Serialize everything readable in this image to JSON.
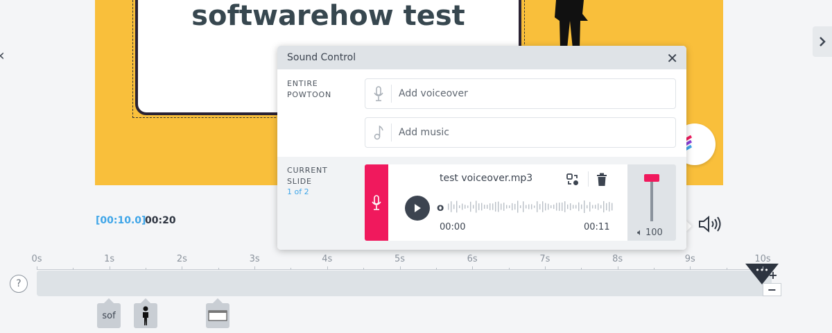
{
  "slide": {
    "title": "softwarehow test"
  },
  "player": {
    "current_time": "[00:10.0]",
    "total_time": "00:20"
  },
  "timeline": {
    "labels": [
      "0s",
      "1s",
      "2s",
      "3s",
      "4s",
      "5s",
      "6s",
      "7s",
      "8s",
      "9s",
      "10s"
    ],
    "help": "?",
    "zoom_in": "+",
    "zoom_out": "−",
    "marker_glyph": "•••",
    "thumbs": [
      {
        "label": "sof",
        "icon": "text-icon"
      },
      {
        "label": "",
        "icon": "person-icon"
      },
      {
        "label": "",
        "icon": "frame-icon"
      }
    ]
  },
  "sound_control": {
    "title": "Sound Control",
    "entire_label_line1": "ENTIRE",
    "entire_label_line2": "POWTOON",
    "add_voiceover": "Add voiceover",
    "add_music": "Add music",
    "current_label_line1": "CURRENT",
    "current_label_line2": "SLIDE",
    "slide_position": "1 of 2",
    "track": {
      "filename": "test voiceover.mp3",
      "start": "00:00",
      "end": "00:11",
      "play_position_marker": "o"
    },
    "volume": {
      "value": "100",
      "level_fraction": 1.0
    }
  },
  "colors": {
    "accent_pink": "#f0195d",
    "accent_blue": "#3ea5e8",
    "stage_yellow": "#f9bf3b"
  }
}
